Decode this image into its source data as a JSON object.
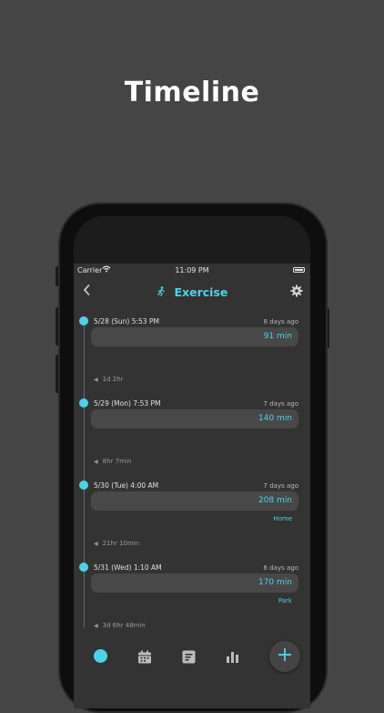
{
  "promo": {
    "title": "Timeline"
  },
  "status_bar": {
    "carrier": "Carrier",
    "time": "11:09 PM"
  },
  "nav": {
    "title": "Exercise",
    "back_icon": "chevron-left-icon",
    "settings_icon": "gear-icon",
    "activity_icon": "running-icon"
  },
  "entries": [
    {
      "date": "5/28 (Sun)  5:53 PM",
      "ago": "8 days ago",
      "duration": "91 min",
      "place": ""
    },
    {
      "date": "5/29 (Mon)  7:53 PM",
      "ago": "7 days ago",
      "duration": "140 min",
      "place": ""
    },
    {
      "date": "5/30 (Tue)  4:00 AM",
      "ago": "7 days ago",
      "duration": "208 min",
      "place": "Home"
    },
    {
      "date": "5/31 (Wed)  1:10 AM",
      "ago": "6 days ago",
      "duration": "170 min",
      "place": "Park"
    }
  ],
  "gaps": [
    "1d 2hr",
    "8hr 7min",
    "21hr 10min",
    "3d 6hr 48min"
  ],
  "tabbar": {
    "tabs": [
      "timeline-tab",
      "calendar-tab",
      "notes-tab",
      "stats-tab"
    ],
    "add_label": "+"
  },
  "colors": {
    "accent": "#4fd2e6",
    "background": "#454545",
    "screen": "#333333"
  }
}
